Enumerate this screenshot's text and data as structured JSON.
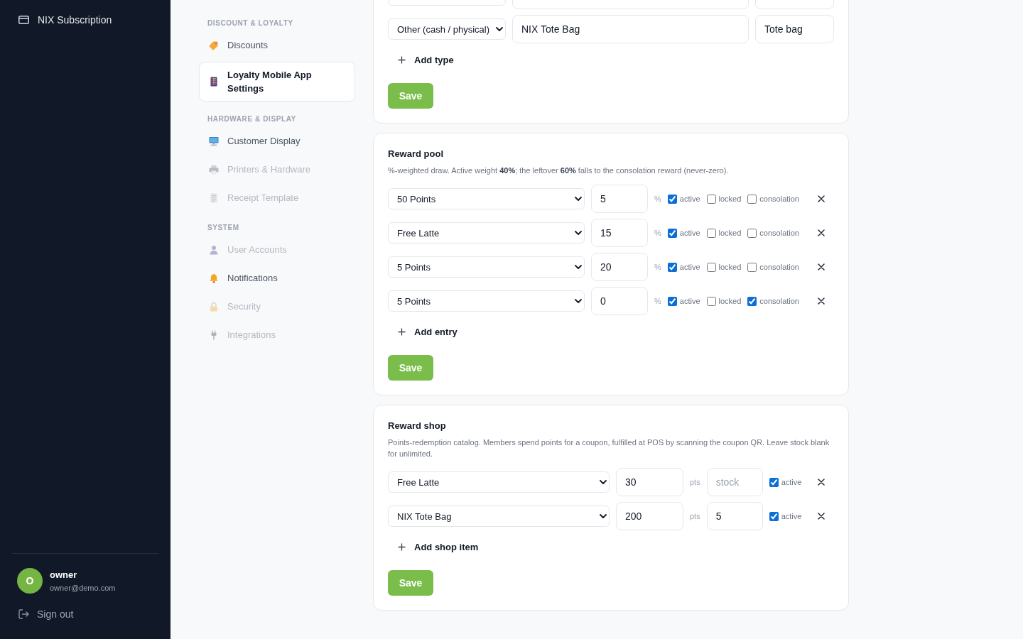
{
  "sidebar": {
    "items": [
      {
        "label": "NIX Subscription",
        "kind": "subscription"
      }
    ],
    "user": {
      "initial": "O",
      "name": "owner",
      "email": "owner@demo.com"
    },
    "sign_out": {
      "label": "Sign out"
    }
  },
  "settings_nav": {
    "sections": [
      {
        "heading": "DISCOUNT & LOYALTY",
        "items": [
          {
            "label": "Discounts",
            "kind": "discounts",
            "selected": false,
            "disabled": false
          },
          {
            "label": "Loyalty Mobile App Settings",
            "kind": "loyalty",
            "selected": true,
            "disabled": false
          }
        ]
      },
      {
        "heading": "HARDWARE & DISPLAY",
        "items": [
          {
            "label": "Customer Display",
            "kind": "display",
            "selected": false,
            "disabled": false
          },
          {
            "label": "Printers & Hardware",
            "kind": "printers",
            "selected": false,
            "disabled": true
          },
          {
            "label": "Receipt Template",
            "kind": "receipt",
            "selected": false,
            "disabled": true
          }
        ]
      },
      {
        "heading": "SYSTEM",
        "items": [
          {
            "label": "User Accounts",
            "kind": "users",
            "selected": false,
            "disabled": true
          },
          {
            "label": "Notifications",
            "kind": "notifications",
            "selected": false,
            "disabled": false
          },
          {
            "label": "Security",
            "kind": "security",
            "selected": false,
            "disabled": true
          },
          {
            "label": "Integrations",
            "kind": "integrations",
            "selected": false,
            "disabled": true
          }
        ]
      }
    ]
  },
  "reward_types": {
    "rows": [
      {},
      {
        "type": "Other (cash / physical)",
        "name": "NIX Tote Bag",
        "column_3": "Tote bag"
      }
    ],
    "add_button": "Add type",
    "save_button": "Save"
  },
  "reward_pool": {
    "title": "Reward pool",
    "description": "%-weighted draw. Active weight **40%**; the leftover **60%** falls to the consolation reward (never-zero).",
    "rows": [
      {
        "reward": "50 Points",
        "weight": "5",
        "unit": "%",
        "flags": [
          {
            "label": "active",
            "checked": true
          },
          {
            "label": "locked",
            "checked": false
          },
          {
            "label": "consolation",
            "checked": false
          }
        ]
      },
      {
        "reward": "Free Latte",
        "weight": "15",
        "unit": "%",
        "flags": [
          {
            "label": "active",
            "checked": true
          },
          {
            "label": "locked",
            "checked": false
          },
          {
            "label": "consolation",
            "checked": false
          }
        ]
      },
      {
        "reward": "5 Points",
        "weight": "20",
        "unit": "%",
        "flags": [
          {
            "label": "active",
            "checked": true
          },
          {
            "label": "locked",
            "checked": false
          },
          {
            "label": "consolation",
            "checked": false
          }
        ]
      },
      {
        "reward": "5 Points",
        "weight": "0",
        "unit": "%",
        "flags": [
          {
            "label": "active",
            "checked": true
          },
          {
            "label": "locked",
            "checked": false
          },
          {
            "label": "consolation",
            "checked": true
          }
        ]
      }
    ],
    "add_button": "Add entry",
    "save_button": "Save"
  },
  "reward_shop": {
    "title": "Reward shop",
    "description": "Points-redemption catalog. Members spend points for a coupon, fulfilled at POS by scanning the coupon QR. Leave stock blank for unlimited.",
    "rows": [
      {
        "reward": "Free Latte",
        "points": "30",
        "unit": "pts",
        "stock": {
          "placeholder": "stock"
        },
        "flags": [
          {
            "label": "active",
            "checked": true
          }
        ]
      },
      {
        "reward": "NIX Tote Bag",
        "points": "200",
        "unit": "pts",
        "stock": {
          "value": "5"
        },
        "flags": [
          {
            "label": "active",
            "checked": true
          }
        ]
      }
    ],
    "add_button": "Add shop item",
    "save_button": "Save"
  }
}
